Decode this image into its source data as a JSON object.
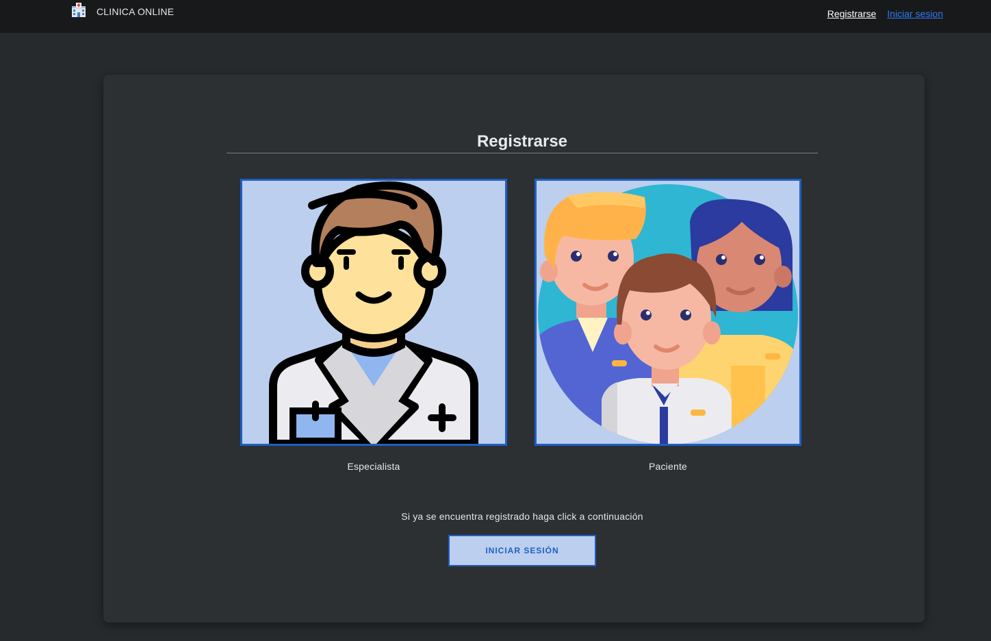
{
  "navbar": {
    "brand_label": "CLINICA ONLINE",
    "brand_icon": "hospital-icon",
    "links": [
      {
        "label": "Registrarse"
      },
      {
        "label": "Iniciar sesion"
      }
    ]
  },
  "register": {
    "title": "Registrarse",
    "options": [
      {
        "label": "Especialista",
        "icon": "doctor-avatar"
      },
      {
        "label": "Paciente",
        "icon": "patients-group-avatar"
      }
    ],
    "hint": "Si ya se encuentra registrado haga click a continuación",
    "login_button_label": "INICIAR SESIÓN"
  },
  "colors": {
    "navbar_bg": "#17191b",
    "page_bg": "#272a2d",
    "card_bg": "#2c3033",
    "accent": "#1e5fc4",
    "tile_bg": "#bccfee",
    "link_blue": "#2f7cf6"
  }
}
